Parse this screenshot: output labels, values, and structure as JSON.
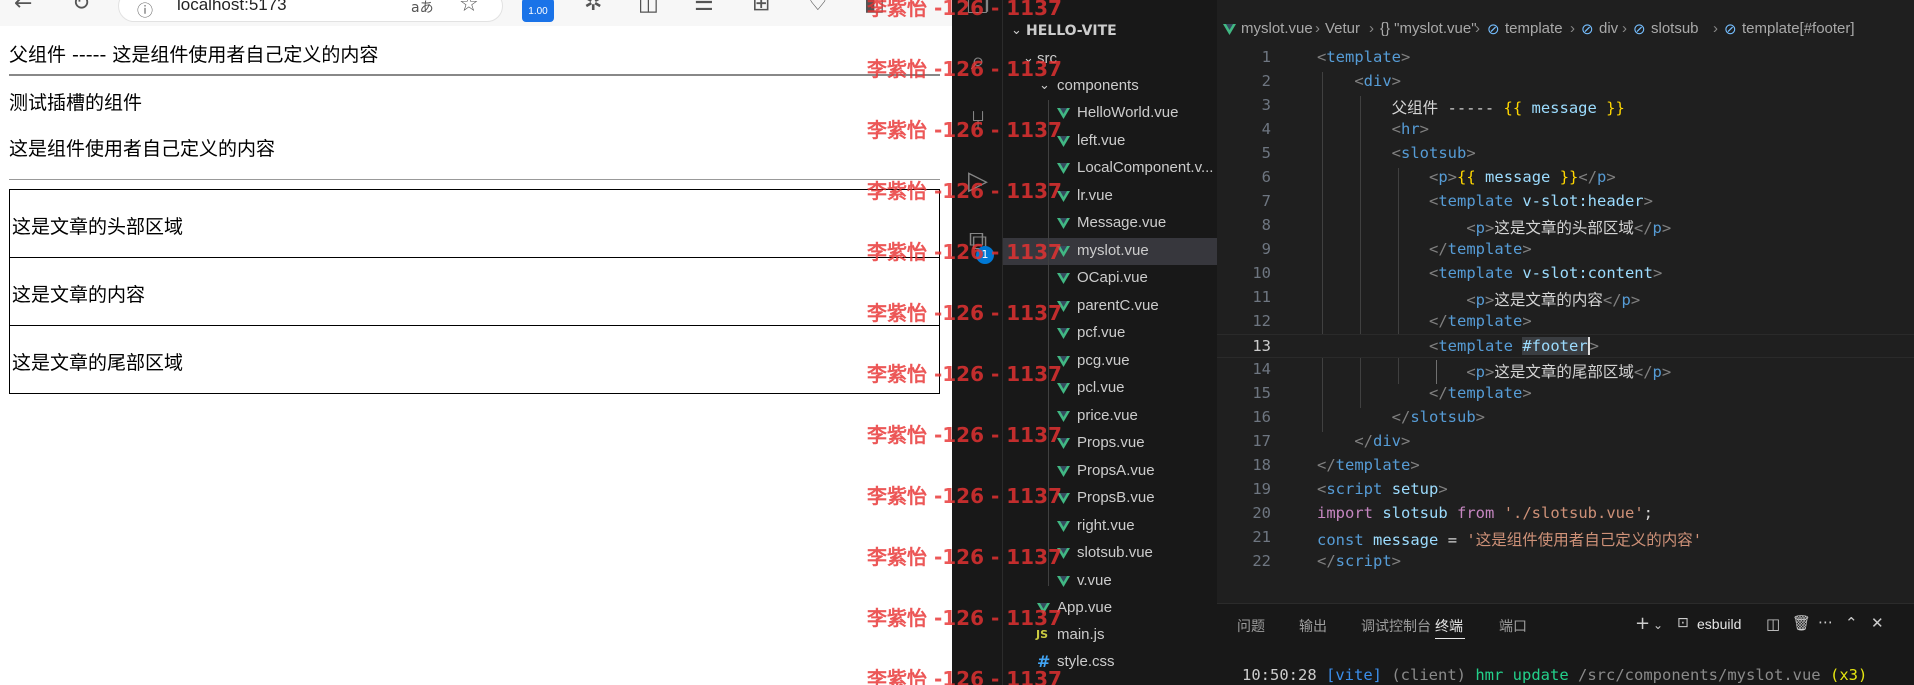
{
  "browser": {
    "url": "localhost:5173",
    "reader_glyph": "aあ",
    "extension_badge": "1.00",
    "page": {
      "parent_line": "父组件 ----- 这是组件使用者自己定义的内容",
      "title": "测试插槽的组件",
      "message": "这是组件使用者自己定义的内容",
      "header": "这是文章的头部区域",
      "content": "这是文章的内容",
      "footer": "这是文章的尾部区域"
    }
  },
  "vscode": {
    "activity_badge": "1",
    "explorer": {
      "project": "HELLO-VITE",
      "folders": {
        "src": "src",
        "components": "components"
      },
      "files": [
        "HelloWorld.vue",
        "left.vue",
        "LocalComponent.v...",
        "lr.vue",
        "Message.vue",
        "myslot.vue",
        "OCapi.vue",
        "parentC.vue",
        "pcf.vue",
        "pcg.vue",
        "pcl.vue",
        "price.vue",
        "Props.vue",
        "PropsA.vue",
        "PropsB.vue",
        "right.vue",
        "slotsub.vue",
        "v.vue"
      ],
      "root_files": [
        "App.vue",
        "main.js",
        "style.css"
      ],
      "selected": "myslot.vue"
    },
    "breadcrumb": [
      "myslot.vue",
      "Vetur",
      "{} \"myslot.vue\"",
      "template",
      "div",
      "slotsub",
      "template[#footer]"
    ],
    "line_numbers": [
      "1",
      "2",
      "3",
      "4",
      "5",
      "6",
      "7",
      "8",
      "9",
      "10",
      "11",
      "12",
      "13",
      "14",
      "15",
      "16",
      "17",
      "18",
      "19",
      "20",
      "21",
      "22"
    ],
    "active_line": "13",
    "code": {
      "tag_template": "template",
      "tag_div": "div",
      "text_parent": "父组件 ----- ",
      "mustache_open": "{{",
      "mustache_close": "}}",
      "var_message": "message",
      "tag_hr": "hr",
      "tag_slotsub": "slotsub",
      "tag_p": "p",
      "slot_header": "v-slot:header",
      "slot_content": "v-slot:content",
      "slot_footer": "#footer",
      "text_header": "这是文章的头部区域",
      "text_content": "这是文章的内容",
      "text_footer": "这是文章的尾部区域",
      "tag_script": "script",
      "attr_setup": "setup",
      "kw_import": "import",
      "id_slotsub": "slotsub",
      "kw_from": "from",
      "str_path": "'./slotsub.vue'",
      "kw_const": "const",
      "str_message": "'这是组件使用者自己定义的内容'"
    },
    "panel": {
      "tabs": [
        "问题",
        "输出",
        "调试控制台",
        "终端",
        "端口"
      ],
      "active_tab": "终端",
      "terminal_profile": "esbuild",
      "terminal": {
        "time": "10:50:28",
        "tag": "[vite]",
        "source": "(client)",
        "event": "hmr update",
        "path": "/src/components/myslot.vue",
        "count": "(x3)"
      }
    }
  },
  "watermark": "李紫怡 -126 - 1137",
  "colors": {
    "vue_green": "#41b883",
    "accent_blue": "#0078d4",
    "watermark_red": "#e83232"
  }
}
